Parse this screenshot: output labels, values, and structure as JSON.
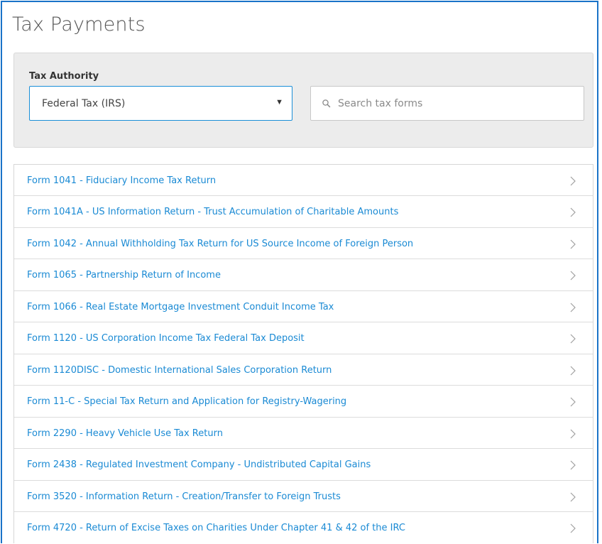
{
  "page": {
    "title": "Tax Payments"
  },
  "filters": {
    "authority_label": "Tax Authority",
    "authority_selected": "Federal Tax (IRS)",
    "search_placeholder": "Search tax forms",
    "search_value": ""
  },
  "forms": [
    {
      "label": "Form 1041 - Fiduciary Income Tax Return"
    },
    {
      "label": "Form 1041A - US Information Return - Trust Accumulation of Charitable Amounts"
    },
    {
      "label": "Form 1042 - Annual Withholding Tax Return for US Source Income of Foreign Person"
    },
    {
      "label": "Form 1065 - Partnership Return of Income"
    },
    {
      "label": "Form 1066 - Real Estate Mortgage Investment Conduit Income Tax"
    },
    {
      "label": "Form 1120 - US Corporation Income Tax Federal Tax Deposit"
    },
    {
      "label": "Form 1120DISC - Domestic International Sales Corporation Return"
    },
    {
      "label": "Form 11-C - Special Tax Return and Application for Registry-Wagering"
    },
    {
      "label": "Form 2290 - Heavy Vehicle Use Tax Return"
    },
    {
      "label": "Form 2438 - Regulated Investment Company - Undistributed Capital Gains"
    },
    {
      "label": "Form 3520 - Information Return - Creation/Transfer to Foreign Trusts"
    },
    {
      "label": "Form 4720 - Return of Excise Taxes on Charities Under Chapter 41 & 42 of the IRC"
    }
  ],
  "icons": {
    "search": "search-icon",
    "select_caret": "caret-down-icon",
    "row_chevron": "chevron-right-icon"
  },
  "colors": {
    "accent": "#1a73c8",
    "link": "#1a8ad4",
    "panel_bg": "#ececec"
  }
}
